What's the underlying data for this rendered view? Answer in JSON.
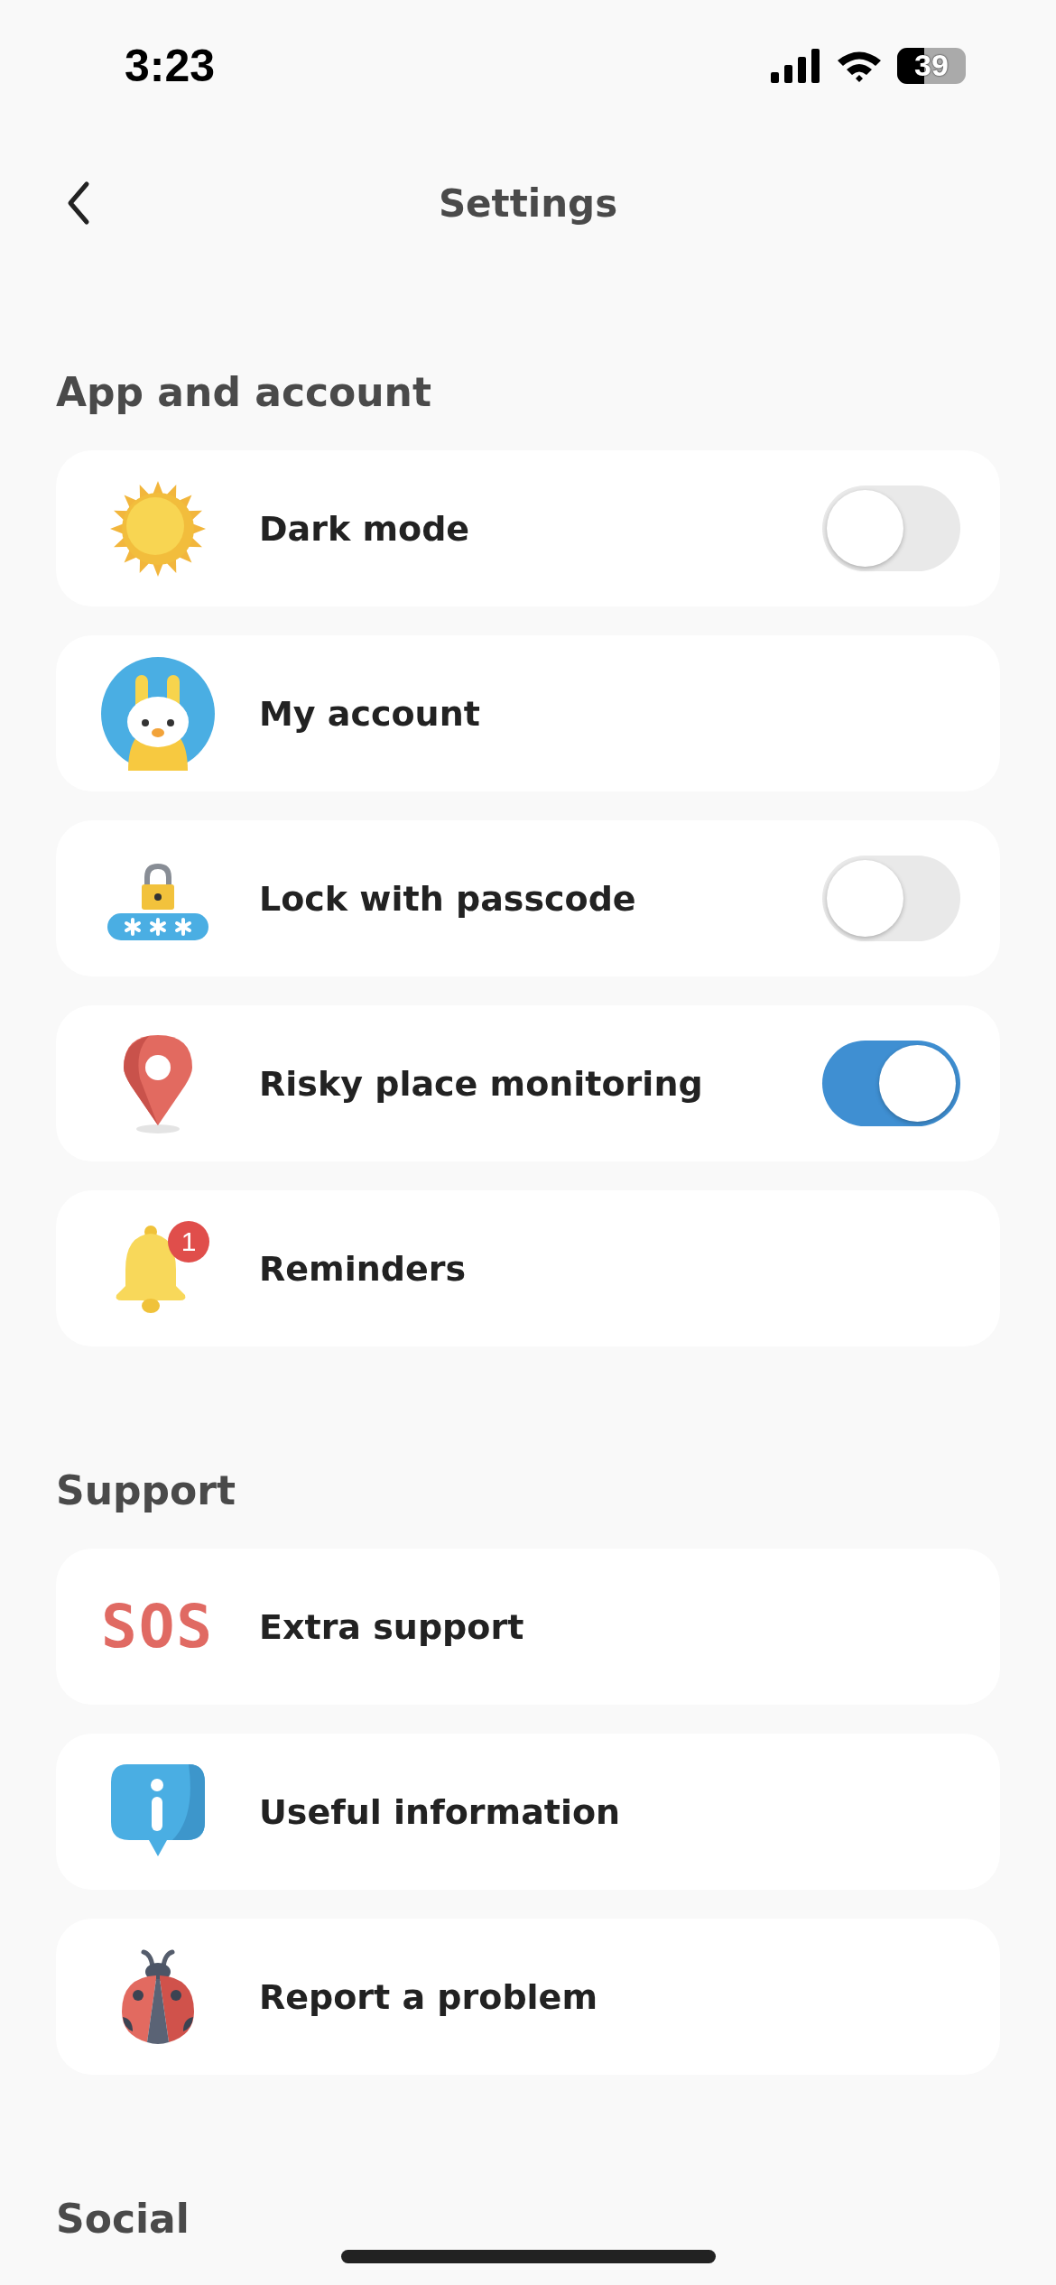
{
  "status_bar": {
    "time": "3:23",
    "battery": "39"
  },
  "nav": {
    "title": "Settings"
  },
  "sections": [
    {
      "title": "App and account",
      "items": [
        {
          "label": "Dark mode",
          "toggle": {
            "on": false
          }
        },
        {
          "label": "My account"
        },
        {
          "label": "Lock with passcode",
          "toggle": {
            "on": false
          }
        },
        {
          "label": "Risky place monitoring",
          "toggle": {
            "on": true
          }
        },
        {
          "label": "Reminders",
          "badge": "1"
        }
      ]
    },
    {
      "title": "Support",
      "items": [
        {
          "label": "Extra support",
          "icon_text": "SOS"
        },
        {
          "label": "Useful information"
        },
        {
          "label": "Report a problem"
        }
      ]
    },
    {
      "title": "Social"
    }
  ]
}
